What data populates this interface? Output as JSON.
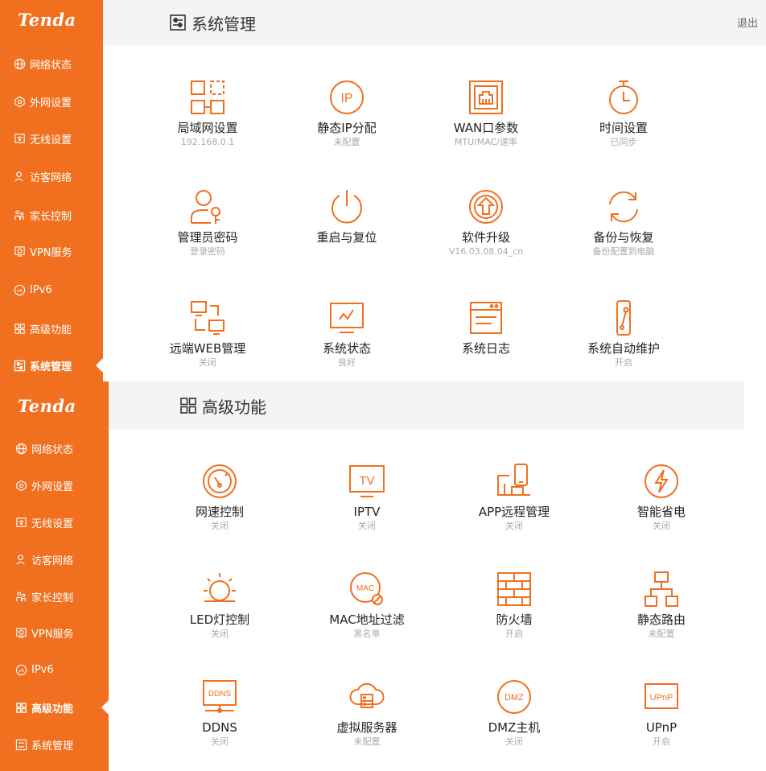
{
  "brand": "Tenda",
  "logout": "退出",
  "nav": [
    "网络状态",
    "外网设置",
    "无线设置",
    "访客网络",
    "家长控制",
    "VPN服务",
    "IPv6",
    "高级功能",
    "系统管理"
  ],
  "system_section": {
    "title": "系统管理",
    "tiles": [
      {
        "label": "局域网设置",
        "sub": "192.168.0.1",
        "icon": "lan-icon"
      },
      {
        "label": "静态IP分配",
        "sub": "未配置",
        "icon": "ip-icon"
      },
      {
        "label": "WAN口参数",
        "sub": "MTU/MAC/速率",
        "icon": "wan-port-icon"
      },
      {
        "label": "时间设置",
        "sub": "已同步",
        "icon": "clock-icon"
      },
      {
        "label": "管理员密码",
        "sub": "登录密码",
        "icon": "admin-key-icon"
      },
      {
        "label": "重启与复位",
        "sub": "",
        "icon": "power-icon"
      },
      {
        "label": "软件升级",
        "sub": "V16.03.08.04_cn",
        "icon": "upgrade-icon"
      },
      {
        "label": "备份与恢复",
        "sub": "备份配置到电脑",
        "icon": "backup-icon"
      },
      {
        "label": "远端WEB管理",
        "sub": "关闭",
        "icon": "remote-web-icon"
      },
      {
        "label": "系统状态",
        "sub": "良好",
        "icon": "monitor-icon"
      },
      {
        "label": "系统日志",
        "sub": "",
        "icon": "log-icon"
      },
      {
        "label": "系统自动维护",
        "sub": "开启",
        "icon": "maintenance-icon"
      }
    ]
  },
  "advanced_section": {
    "title": "高级功能",
    "tiles": [
      {
        "label": "网速控制",
        "sub": "关闭",
        "icon": "speedometer-icon"
      },
      {
        "label": "IPTV",
        "sub": "关闭",
        "icon": "tv-icon"
      },
      {
        "label": "APP远程管理",
        "sub": "关闭",
        "icon": "app-remote-icon"
      },
      {
        "label": "智能省电",
        "sub": "关闭",
        "icon": "power-saving-icon"
      },
      {
        "label": "LED灯控制",
        "sub": "关闭",
        "icon": "led-icon"
      },
      {
        "label": "MAC地址过滤",
        "sub": "黑名单",
        "icon": "mac-filter-icon"
      },
      {
        "label": "防火墙",
        "sub": "开启",
        "icon": "firewall-icon"
      },
      {
        "label": "静态路由",
        "sub": "未配置",
        "icon": "static-route-icon"
      },
      {
        "label": "DDNS",
        "sub": "关闭",
        "icon": "ddns-icon"
      },
      {
        "label": "虚拟服务器",
        "sub": "未配置",
        "icon": "virtual-server-icon"
      },
      {
        "label": "DMZ主机",
        "sub": "关闭",
        "icon": "dmz-icon"
      },
      {
        "label": "UPnP",
        "sub": "开启",
        "icon": "upnp-icon"
      }
    ]
  },
  "icon_text": {
    "ip": "IP",
    "tv": "TV",
    "mac": "MAC",
    "ddns": "DDNS",
    "dmz": "DMZ",
    "upnp": "UPnP"
  },
  "accent_color": "#f07020"
}
